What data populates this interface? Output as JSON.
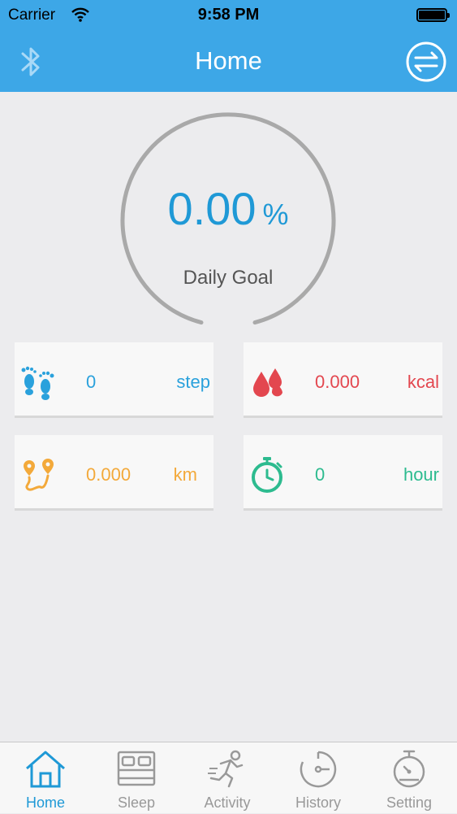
{
  "status_bar": {
    "carrier": "Carrier",
    "time": "9:58 PM"
  },
  "nav": {
    "title": "Home",
    "left_icon": "bluetooth-icon",
    "right_icon": "sync-icon"
  },
  "goal": {
    "value": "0.00",
    "unit": "%",
    "label": "Daily Goal",
    "progress_fraction": 0.0
  },
  "stats": {
    "steps": {
      "value": "0",
      "unit": "step",
      "icon": "footprints-icon",
      "color": "#2aa1dc"
    },
    "calories": {
      "value": "0.000",
      "unit": "kcal",
      "icon": "flame-icon",
      "color": "#e3474f"
    },
    "distance": {
      "value": "0.000",
      "unit": "km",
      "icon": "route-icon",
      "color": "#f3a93a"
    },
    "duration": {
      "value": "0",
      "unit": "hour",
      "icon": "stopwatch-icon",
      "color": "#2dbb8f"
    }
  },
  "tabs": [
    {
      "label": "Home",
      "icon": "home-icon",
      "active": true
    },
    {
      "label": "Sleep",
      "icon": "bed-icon",
      "active": false
    },
    {
      "label": "Activity",
      "icon": "running-icon",
      "active": false
    },
    {
      "label": "History",
      "icon": "history-icon",
      "active": false
    },
    {
      "label": "Setting",
      "icon": "timer-icon",
      "active": false
    }
  ],
  "colors": {
    "accent": "#3da7e7",
    "active_tab": "#1f99d6",
    "ring": "#a9a9a9"
  }
}
